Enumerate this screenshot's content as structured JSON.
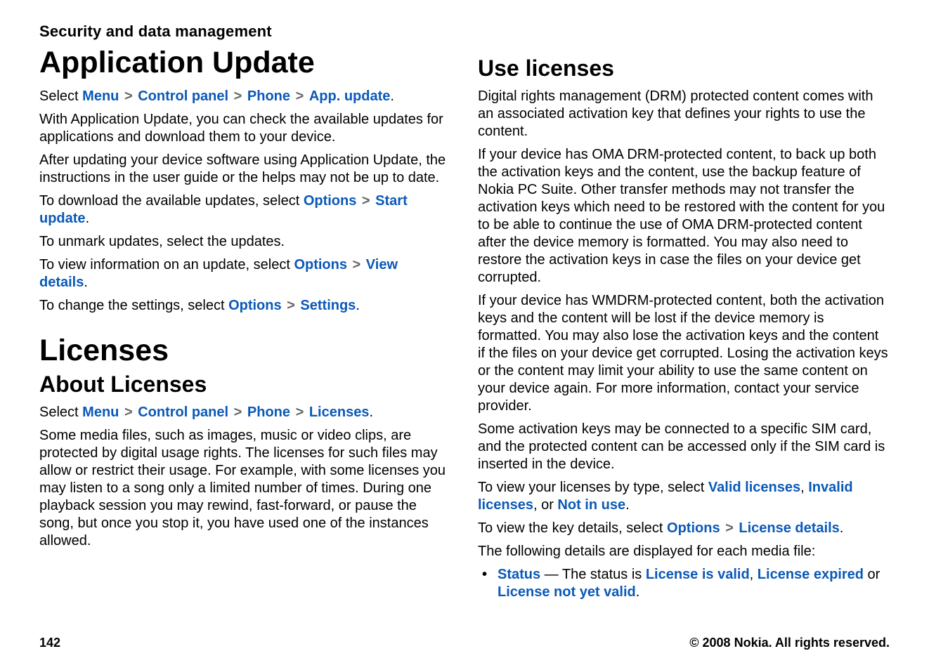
{
  "header": {
    "section_title": "Security and data management"
  },
  "left": {
    "app_update": {
      "title": "Application Update",
      "nav": {
        "prefix": "Select ",
        "items": [
          "Menu",
          "Control panel",
          "Phone",
          "App. update"
        ],
        "sep": ">",
        "suffix": "."
      },
      "p1": "With Application Update, you can check the available updates for applications and download them to your device.",
      "p2": "After updating your device software using Application Update, the instructions in the user guide or the helps may not be up to date.",
      "p3": {
        "t1": "To download the available updates, select ",
        "k1": "Options",
        "sep": " > ",
        "k2": "Start update",
        "t2": "."
      },
      "p4": "To unmark updates, select the updates.",
      "p5": {
        "t1": "To view information on an update, select ",
        "k1": "Options",
        "sep": " > ",
        "k2": "View details",
        "t2": "."
      },
      "p6": {
        "t1": "To change the settings, select ",
        "k1": "Options",
        "sep": " > ",
        "k2": "Settings",
        "t2": "."
      }
    },
    "licenses": {
      "title": "Licenses",
      "about_title": "About Licenses",
      "nav": {
        "prefix": "Select ",
        "items": [
          "Menu",
          "Control panel",
          "Phone",
          "Licenses"
        ],
        "sep": ">",
        "suffix": "."
      },
      "p1": "Some media files, such as images, music or video clips, are protected by digital usage rights. The licenses for such files may allow or restrict their usage. For example, with some licenses you may listen to a song only a limited number of times. During one playback session you may rewind, fast-forward, or pause the song, but once you stop it, you have used one of the instances allowed."
    }
  },
  "right": {
    "use_licenses": {
      "title": "Use licenses",
      "p1": "Digital rights management (DRM) protected content comes with an associated activation key that defines your rights to use the content.",
      "p2": "If your device has OMA DRM-protected content, to back up both the activation keys and the content, use the backup feature of Nokia PC Suite. Other transfer methods may not transfer the activation keys which need to be restored with the content for you to be able to continue the use of OMA DRM-protected content after the device memory is formatted. You may also need to restore the activation keys in case the files on your device get corrupted.",
      "p3": "If your device has WMDRM-protected content, both the activation keys and the content will be lost if the device memory is formatted. You may also lose the activation keys and the content if the files on your device get corrupted. Losing the activation keys or the content may limit your ability to use the same content on your device again. For more information, contact your service provider.",
      "p4": "Some activation keys may be connected to a specific SIM card, and the protected content can be accessed only if the SIM card is inserted in the device.",
      "p5": {
        "t1": "To view your licenses by type, select ",
        "k1": "Valid licenses",
        "c1": ", ",
        "k2": "Invalid licenses",
        "c2": ", or ",
        "k3": "Not in use",
        "t2": "."
      },
      "p6": {
        "t1": "To view the key details, select ",
        "k1": "Options",
        "sep": " > ",
        "k2": "License details",
        "t2": "."
      },
      "p7": "The following details are displayed for each media file:",
      "bullet1": {
        "k1": "Status",
        "t1": " — The status is ",
        "k2": "License is valid",
        "c1": ", ",
        "k3": "License expired",
        "t2": " or ",
        "k4": "License not yet valid",
        "t3": "."
      }
    }
  },
  "footer": {
    "page_number": "142",
    "copyright": "© 2008 Nokia. All rights reserved."
  }
}
